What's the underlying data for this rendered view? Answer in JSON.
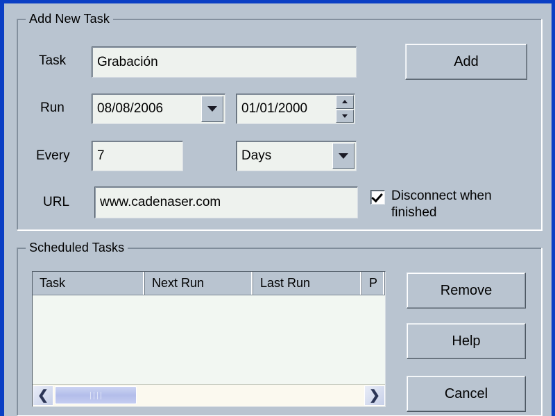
{
  "window": {
    "border_color": "#0b3fc4",
    "client_bg": "#b9c4d0"
  },
  "add_task_group": {
    "legend": "Add New Task",
    "fields": {
      "task": {
        "label": "Task",
        "value": "Grabación",
        "placeholder": ""
      },
      "run": {
        "label": "Run",
        "date_value": "08/08/2006",
        "time_value": "01/01/2000",
        "date_dropdown_icon": "chevron-down-icon",
        "spinner_up_icon": "arrow-up-icon",
        "spinner_down_icon": "arrow-down-icon"
      },
      "every": {
        "label": "Every",
        "value": "7",
        "unit_value": "Days",
        "unit_dropdown_icon": "chevron-down-icon"
      },
      "url": {
        "label": "URL",
        "value": "www.cadenaser.com",
        "placeholder": ""
      }
    },
    "disconnect_checkbox": {
      "label": "Disconnect when finished",
      "checked": true,
      "check_icon": "checkmark-icon"
    },
    "add_button": "Add"
  },
  "scheduled_tasks_group": {
    "legend": "Scheduled Tasks",
    "table": {
      "columns": [
        "Task",
        "Next Run",
        "Last Run",
        "P"
      ],
      "rows": []
    },
    "scrollbar": {
      "left_arrow_icon": "chevron-left-icon",
      "right_arrow_icon": "chevron-right-icon",
      "left_arrow_glyph": "❮",
      "right_arrow_glyph": "❯"
    },
    "buttons": {
      "remove": "Remove",
      "help": "Help",
      "cancel": "Cancel"
    }
  }
}
